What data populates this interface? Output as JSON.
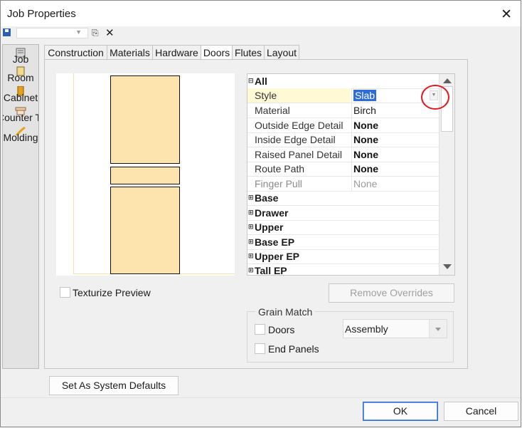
{
  "window": {
    "title": "Job Properties"
  },
  "toolbar": {
    "combo_value": ""
  },
  "sidebar": {
    "items": [
      {
        "label": "Job"
      },
      {
        "label": "Room"
      },
      {
        "label": "Cabinet"
      },
      {
        "label": "Counter T"
      },
      {
        "label": "Molding"
      }
    ]
  },
  "tabs": [
    {
      "label": "Construction"
    },
    {
      "label": "Materials"
    },
    {
      "label": "Hardware"
    },
    {
      "label": "Doors",
      "active": true
    },
    {
      "label": "Flutes"
    },
    {
      "label": "Layout"
    }
  ],
  "property_grid": {
    "all_label": "All",
    "properties": [
      {
        "name": "Style",
        "value": "Slab"
      },
      {
        "name": "Material",
        "value": "Birch"
      },
      {
        "name": "Outside Edge Detail",
        "value": "None"
      },
      {
        "name": "Inside Edge Detail",
        "value": "None"
      },
      {
        "name": "Raised Panel Detail",
        "value": "None"
      },
      {
        "name": "Route Path",
        "value": "None"
      },
      {
        "name": "Finger Pull",
        "value": "None"
      }
    ],
    "categories": [
      "Base",
      "Drawer",
      "Upper",
      "Base EP",
      "Upper EP",
      "Tall EP"
    ]
  },
  "preview": {
    "door_color": "#fde3ae"
  },
  "texturize_label": "Texturize Preview",
  "remove_overrides_label": "Remove Overrides",
  "grain_match": {
    "title": "Grain Match",
    "doors_label": "Doors",
    "doors_value": "Assembly",
    "end_panels_label": "End Panels"
  },
  "buttons": {
    "system_defaults": "Set As System Defaults",
    "ok": "OK",
    "cancel": "Cancel"
  },
  "colors": {
    "highlight": "#2f6dd6",
    "annotation": "#e0161e"
  }
}
